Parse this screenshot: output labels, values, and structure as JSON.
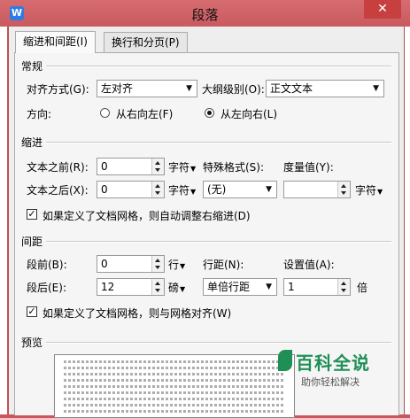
{
  "window": {
    "title": "段落",
    "close_glyph": "✕",
    "app_icon_letter": "W"
  },
  "tabs": [
    {
      "label": "缩进和间距(I)",
      "active": true
    },
    {
      "label": "换行和分页(P)",
      "active": false
    }
  ],
  "general": {
    "title": "常规",
    "alignment_label": "对齐方式(G):",
    "alignment_value": "左对齐",
    "outline_label": "大纲级别(O):",
    "outline_value": "正文文本",
    "direction_label": "方向:",
    "rtl_label": "从右向左(F)",
    "ltr_label": "从左向右(L)",
    "direction_selected": "ltr"
  },
  "indent": {
    "title": "缩进",
    "before_label": "文本之前(R):",
    "before_value": "0",
    "before_unit": "字符",
    "after_label": "文本之后(X):",
    "after_value": "0",
    "after_unit": "字符",
    "special_label": "特殊格式(S):",
    "special_value": "(无)",
    "measure_label": "度量值(Y):",
    "measure_value": "",
    "measure_unit": "字符",
    "auto_adjust_label": "如果定义了文档网格，则自动调整右缩进(D)",
    "auto_adjust_checked": true
  },
  "spacing": {
    "title": "间距",
    "before_label": "段前(B):",
    "before_value": "0",
    "before_unit": "行",
    "after_label": "段后(E):",
    "after_value": "12",
    "after_unit": "磅",
    "line_label": "行距(N):",
    "line_value": "单倍行距",
    "setting_label": "设置值(A):",
    "setting_value": "1",
    "setting_unit": "倍",
    "snap_grid_label": "如果定义了文档网格，则与网格对齐(W)",
    "snap_grid_checked": true
  },
  "preview": {
    "title": "预览"
  },
  "watermark": {
    "title": "百科全说",
    "subtitle": "助你轻松解决"
  },
  "icons": {
    "dropdown": "▼",
    "check": "✓"
  }
}
